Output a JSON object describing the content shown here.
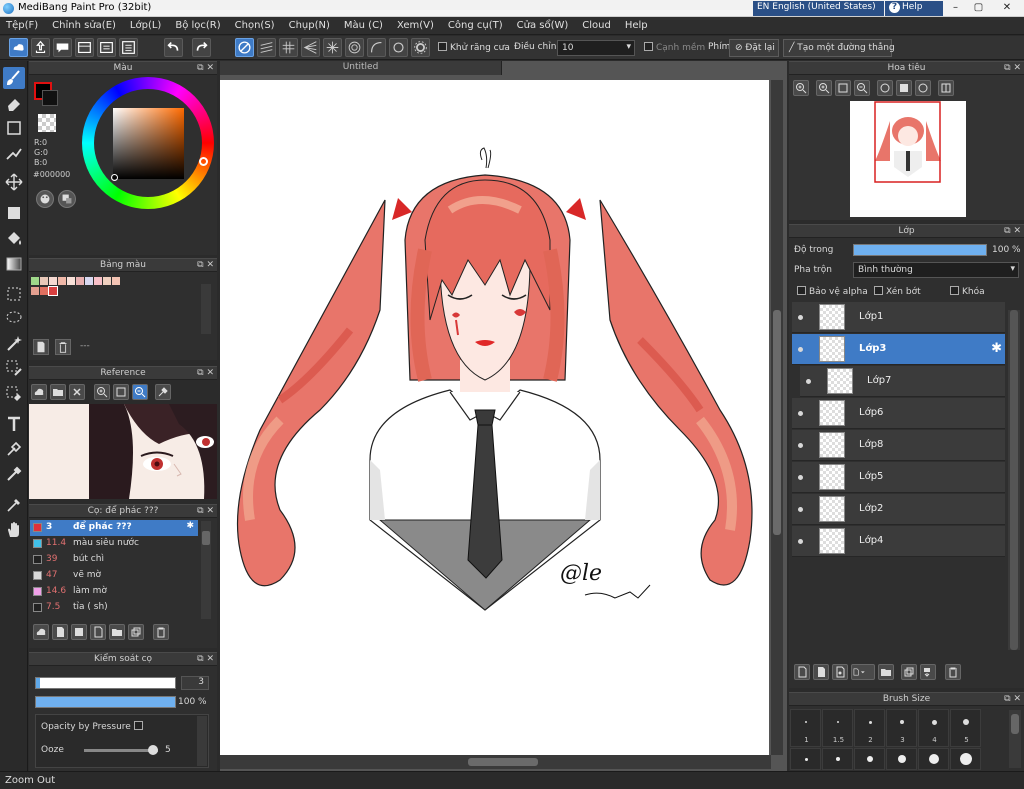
{
  "window": {
    "title": "MediBang Paint Pro (32bit)",
    "language": "EN English (United States)",
    "help": "Help",
    "minimize": "–",
    "maximize": "▢",
    "close": "✕"
  },
  "menu": [
    "Tệp(F)",
    "Chỉnh sửa(E)",
    "Lớp(L)",
    "Bộ lọc(R)",
    "Chọn(S)",
    "Chụp(N)",
    "Màu (C)",
    "Xem(V)",
    "Công cụ(T)",
    "Cửa sổ(W)",
    "Cloud",
    "Help"
  ],
  "toolbar": {
    "antialias_label": "Khử răng cưa",
    "correction_label": "Điều chỉnh",
    "correction_value": "10",
    "soft_edge_label": "Cạnh mềm",
    "shortcut_label": "Phím",
    "reset_label": "Đặt lại",
    "straight_line_label": "Tạo một đường thẳng"
  },
  "color_panel": {
    "title": "Màu",
    "r": "R:0",
    "g": "G:0",
    "b": "B:0",
    "hex": "#000000",
    "primary_color": "#000000",
    "foreground_border": "#e01010"
  },
  "palette_panel": {
    "title": "Bảng màu",
    "swatches": [
      "#9fd88a",
      "#e8c8b8",
      "#f4d8d0",
      "#f0b8a8",
      "#f8e0d8",
      "#e8b0b0",
      "#d8d8f0",
      "#f8c0c8",
      "#f0d0c0",
      "#f4c4b4",
      "#e4a090",
      "#e07060",
      "#d84040"
    ],
    "footer": "---"
  },
  "reference_panel": {
    "title": "Reference"
  },
  "brush_panel": {
    "title": "Cọ: để phác ???",
    "brushes": [
      {
        "size": "3",
        "name": "để phác ???",
        "color": "#e0303a"
      },
      {
        "size": "11.4",
        "name": "màu siêu nước",
        "color": "#40c0e8"
      },
      {
        "size": "39",
        "name": "bút chì",
        "color": "#222222"
      },
      {
        "size": "47",
        "name": "vẽ mờ",
        "color": "#d8d8d8"
      },
      {
        "size": "14.6",
        "name": "làm mờ",
        "color": "#f0a0e8"
      },
      {
        "size": "7.5",
        "name": "tỉa ( sh)",
        "color": "#222222"
      }
    ]
  },
  "brush_control": {
    "title": "Kiểm soát cọ",
    "size_value": "3",
    "opacity_value": "100 %",
    "opacity_by_pressure": "Opacity by Pressure",
    "ooze_label": "Ooze",
    "ooze_value": "5"
  },
  "canvas": {
    "tab_title": "Untitled",
    "signature": "@le"
  },
  "navigator": {
    "title": "Hoa tiêu"
  },
  "layer_panel": {
    "title": "Lớp",
    "opacity_label": "Độ trong",
    "opacity_value": "100 %",
    "blend_label": "Pha trộn",
    "blend_value": "Bình thường",
    "protect_alpha": "Bảo vệ alpha",
    "clipping": "Xén bớt",
    "lock": "Khóa",
    "layers": [
      {
        "name": "Lớp1",
        "selected": false,
        "indent": false
      },
      {
        "name": "Lớp3",
        "selected": true,
        "indent": false
      },
      {
        "name": "Lớp7",
        "selected": false,
        "indent": true
      },
      {
        "name": "Lớp6",
        "selected": false,
        "indent": false
      },
      {
        "name": "Lớp8",
        "selected": false,
        "indent": false
      },
      {
        "name": "Lớp5",
        "selected": false,
        "indent": false
      },
      {
        "name": "Lớp2",
        "selected": false,
        "indent": false
      },
      {
        "name": "Lớp4",
        "selected": false,
        "indent": false
      }
    ]
  },
  "brush_size_panel": {
    "title": "Brush Size",
    "sizes": [
      "1",
      "1.5",
      "2",
      "3",
      "4",
      "5"
    ]
  },
  "status": {
    "text": "Zoom Out"
  }
}
